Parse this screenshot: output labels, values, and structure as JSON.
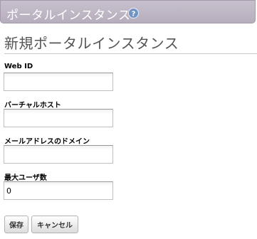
{
  "portlet": {
    "title": "ポータルインスタンス",
    "help_icon": "help-question-icon"
  },
  "form": {
    "heading": "新規ポータルインスタンス",
    "fields": [
      {
        "label": "Web ID",
        "value": "",
        "placeholder": ""
      },
      {
        "label": "バーチャルホスト",
        "value": "",
        "placeholder": ""
      },
      {
        "label": "メールアドレスのドメイン",
        "value": "",
        "placeholder": ""
      },
      {
        "label": "最大ユーザ数",
        "value": "0",
        "placeholder": ""
      }
    ]
  },
  "buttons": {
    "save_label": "保存",
    "cancel_label": "キャンセル"
  },
  "colors": {
    "header_bg": "#bdb4c3",
    "header_text": "#ffffff",
    "help_icon": "#6f93c4",
    "heading_text": "#555555"
  }
}
